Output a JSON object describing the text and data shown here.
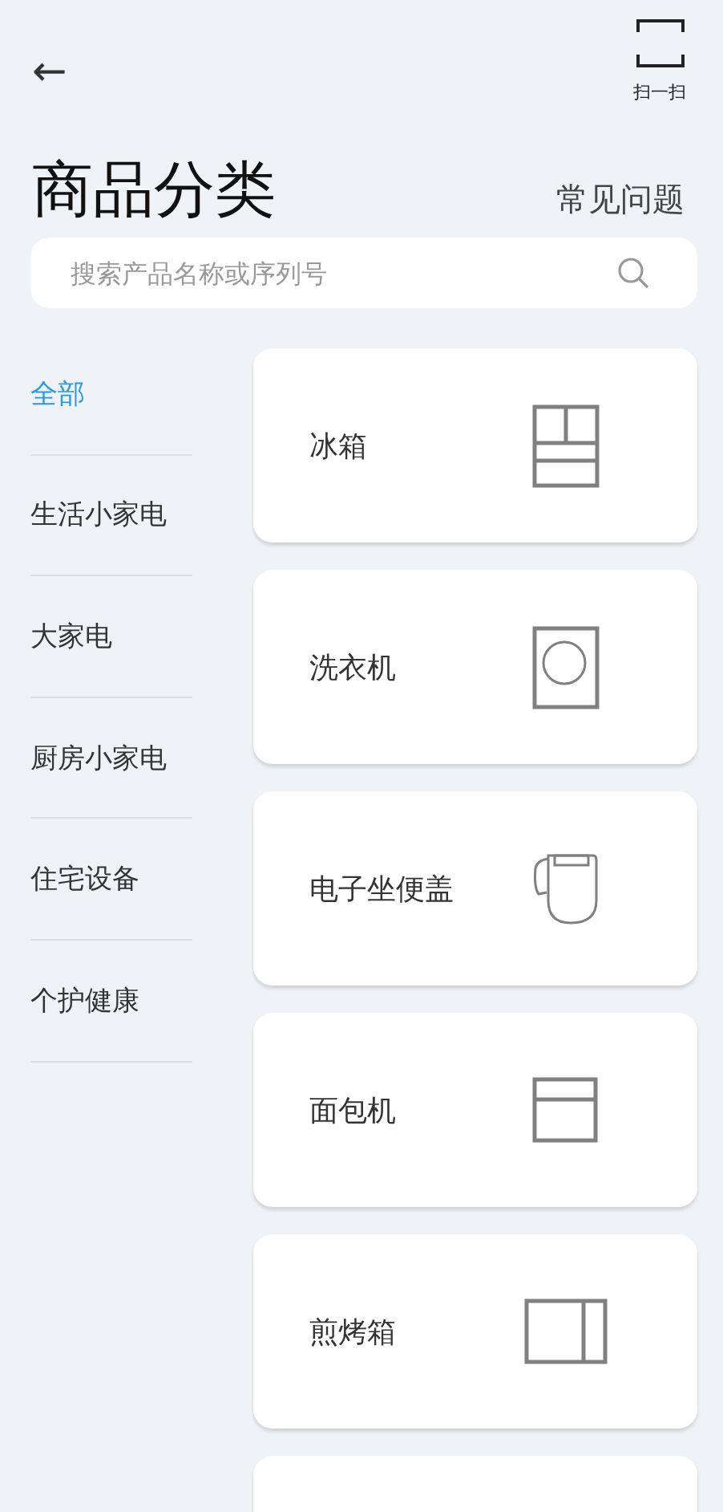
{
  "header": {
    "back": "←",
    "scan_label": "扫一扫"
  },
  "title": "商品分类",
  "faq_link": "常见问题",
  "search": {
    "placeholder": "搜索产品名称或序列号"
  },
  "categories": [
    {
      "label": "全部",
      "selected": true
    },
    {
      "label": "生活小家电",
      "selected": false
    },
    {
      "label": "大家电",
      "selected": false
    },
    {
      "label": "厨房小家电",
      "selected": false
    },
    {
      "label": "住宅设备",
      "selected": false
    },
    {
      "label": "个护健康",
      "selected": false
    }
  ],
  "products": [
    {
      "name": "冰箱",
      "kind": "fridge"
    },
    {
      "name": "洗衣机",
      "kind": "washer"
    },
    {
      "name": "电子坐便盖",
      "kind": "toilet-seat"
    },
    {
      "name": "面包机",
      "kind": "bread-maker"
    },
    {
      "name": "煎烤箱",
      "kind": "oven"
    },
    {
      "kind": "cut-off"
    }
  ]
}
